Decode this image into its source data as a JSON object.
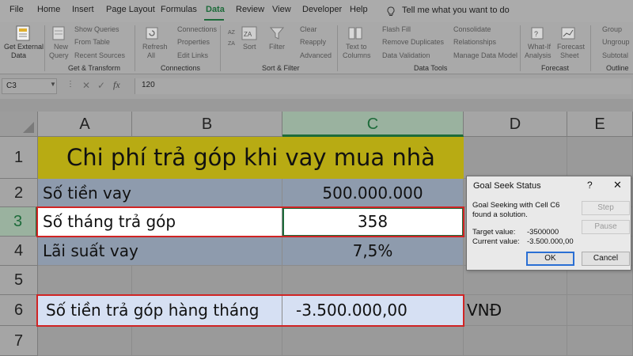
{
  "tabs": [
    {
      "label": "File",
      "active": false
    },
    {
      "label": "Home",
      "active": false
    },
    {
      "label": "Insert",
      "active": false
    },
    {
      "label": "Page Layout",
      "active": false
    },
    {
      "label": "Formulas",
      "active": false
    },
    {
      "label": "Data",
      "active": true
    },
    {
      "label": "Review",
      "active": false
    },
    {
      "label": "View",
      "active": false
    },
    {
      "label": "Developer",
      "active": false
    },
    {
      "label": "Help",
      "active": false
    }
  ],
  "tell_me": "Tell me what you want to do",
  "ribbon": {
    "get_external_data": {
      "line1": "Get External",
      "line2": "Data"
    },
    "new_query": {
      "line1": "New",
      "line2": "Query"
    },
    "show_queries": "Show Queries",
    "from_table": "From Table",
    "recent_sources": "Recent Sources",
    "refresh_all": {
      "line1": "Refresh",
      "line2": "All"
    },
    "connections": "Connections",
    "properties": "Properties",
    "edit_links": "Edit Links",
    "sort": "Sort",
    "filter": "Filter",
    "clear": "Clear",
    "reapply": "Reapply",
    "advanced": "Advanced",
    "text_to_columns": {
      "line1": "Text to",
      "line2": "Columns"
    },
    "flash_fill": "Flash Fill",
    "remove_duplicates": "Remove Duplicates",
    "data_validation": "Data Validation",
    "consolidate": "Consolidate",
    "relationships": "Relationships",
    "manage_data_model": "Manage Data Model",
    "what_if": {
      "line1": "What-If",
      "line2": "Analysis"
    },
    "forecast_sheet": {
      "line1": "Forecast",
      "line2": "Sheet"
    },
    "group": "Group",
    "ungroup": "Ungroup",
    "subtotal": "Subtotal",
    "groups": {
      "get_transform": "Get & Transform",
      "connections": "Connections",
      "sort_filter": "Sort & Filter",
      "data_tools": "Data Tools",
      "forecast": "Forecast",
      "outline": "Outline"
    }
  },
  "formula_bar": {
    "name_box": "C3",
    "value": "120"
  },
  "columns": [
    "A",
    "B",
    "C",
    "D",
    "E"
  ],
  "rows": [
    "1",
    "2",
    "3",
    "4",
    "5",
    "6",
    "7"
  ],
  "sheet": {
    "title": "Chi phí trả góp khi vay mua nhà",
    "a2": "Số tiền vay",
    "c2": "500.000.000",
    "a3": "Số tháng trả góp",
    "c3": "358",
    "a4": "Lãi suất vay",
    "c4": "7,5%",
    "a6": "Số tiền trả góp hàng tháng",
    "c6": "-3.500.000,00",
    "d6": "VNĐ"
  },
  "dialog": {
    "title": "Goal Seek Status",
    "help": "?",
    "close": "✕",
    "message": "Goal Seeking with Cell C6 found a solution.",
    "target_label": "Target value:",
    "target_value": "-3500000",
    "current_label": "Current value:",
    "current_value": "-3.500.000,00",
    "step": "Step",
    "pause": "Pause",
    "ok": "OK",
    "cancel": "Cancel"
  },
  "colors": {
    "accent": "#1d6b3a",
    "title_fill": "#b8ab13",
    "blue_fill": "#8e9bad",
    "light_blue_fill": "#d6e0f3",
    "highlight_border": "#d02424"
  }
}
